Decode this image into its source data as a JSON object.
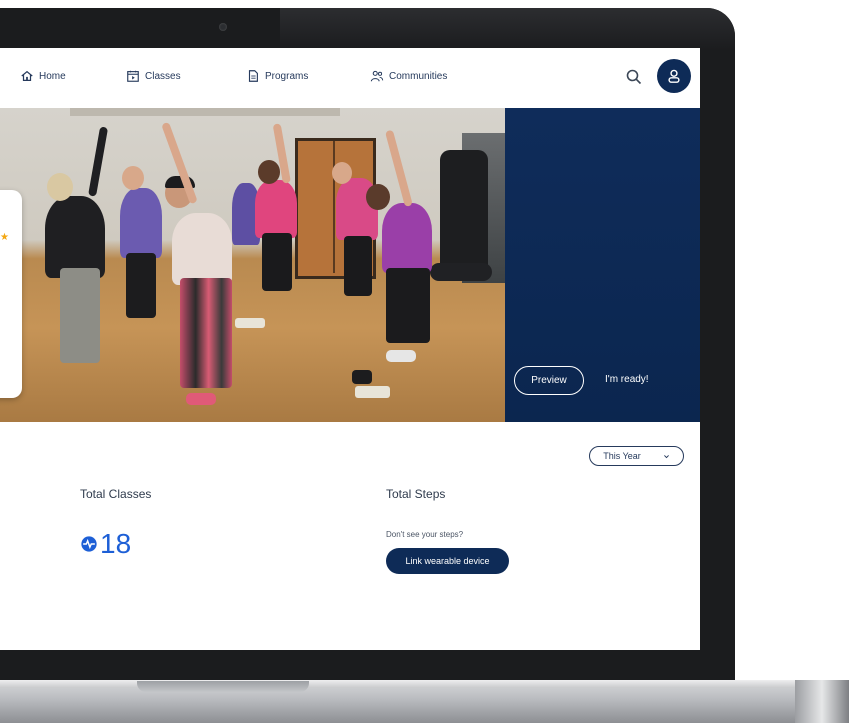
{
  "nav": {
    "items": [
      {
        "label": "Home",
        "icon": "home-icon"
      },
      {
        "label": "Classes",
        "icon": "video-calendar-icon"
      },
      {
        "label": "Programs",
        "icon": "document-icon"
      },
      {
        "label": "Communities",
        "icon": "people-icon"
      }
    ],
    "search_icon": "search-icon",
    "avatar_icon": "user-icon"
  },
  "hero": {
    "preview_label": "Preview",
    "ready_label": "I'm ready!",
    "panel_color": "#0f2c5a"
  },
  "stats": {
    "period_selected": "This Year",
    "total_classes_label": "Total Classes",
    "total_classes_value": "18",
    "total_steps_label": "Total Steps",
    "steps_hint": "Don't see your steps?",
    "link_device_label": "Link wearable device"
  },
  "colors": {
    "brand_navy": "#0e2b57",
    "accent_blue": "#1d5fd6"
  }
}
